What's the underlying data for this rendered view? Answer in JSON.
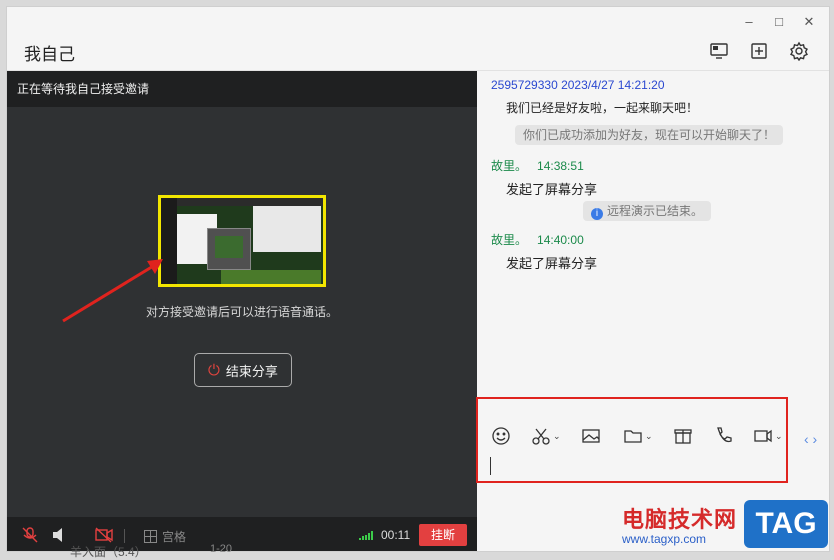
{
  "window": {
    "title": "我自己",
    "controls": [
      "minimize",
      "maximize",
      "close"
    ]
  },
  "header_buttons": [
    "screen-share-icon",
    "add-member-icon",
    "settings-icon"
  ],
  "share_panel": {
    "status": "正在等待我自己接受邀请",
    "hint": "对方接受邀请后可以进行语音通话。",
    "end_share_label": "结束分享"
  },
  "call_bar": {
    "grid_label": "宫格",
    "timer": "00:11",
    "hangup_label": "挂断"
  },
  "chat": {
    "messages": [
      {
        "header": "2595729330 2023/4/27 14:21:20",
        "text": "我们已经是好友啦，一起来聊天吧！",
        "color": "#2a48d0"
      },
      {
        "system": "你们已成功添加为好友，现在可以开始聊天了！"
      },
      {
        "sender": "故里。",
        "time": "14:38:51",
        "text": "发起了屏幕分享",
        "color": "#1b8a4a"
      },
      {
        "system": "远程演示已结束。",
        "info": true
      },
      {
        "sender": "故里。",
        "time": "14:40:00",
        "text": "发起了屏幕分享",
        "color": "#1b8a4a"
      }
    ],
    "toolbar_icons": [
      "emoji-icon",
      "scissors-icon",
      "image-icon",
      "folder-icon",
      "gift-icon",
      "phone-icon",
      "video-icon"
    ]
  },
  "background_stub": {
    "text": "羊入面（5.4）",
    "time": "1-20"
  },
  "watermark": {
    "site": "电脑技术网",
    "url": "www.tagxp.com",
    "tag": "TAG"
  },
  "accent": {
    "hangup": "#e34040",
    "sender_green": "#1b8a4a",
    "link_blue": "#2a48d0",
    "annotation_red": "#e0231e"
  }
}
